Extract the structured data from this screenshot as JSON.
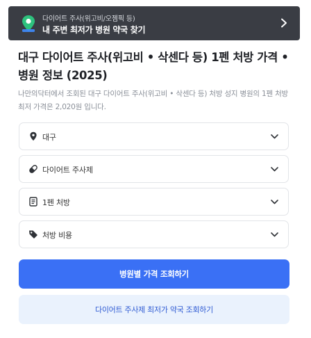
{
  "banner": {
    "subtitle": "다이어트 주사(위고비/오젬픽 등)",
    "title": "내 주변 최저가 병원 약국 찾기",
    "icon": "map-pin-icon",
    "chevron": "chevron-right-icon"
  },
  "page": {
    "title": "대구 다이어트 주사(위고비 • 삭센다 등) 1펜 처방 가격 • 병원 정보 (2025)",
    "description": "나만의닥터에서 조회된 대구 다이어트 주사(위고비 • 삭센다 등) 처방 성지 병원의 1펜 처방 최저 가격은 2,020원 입니다."
  },
  "filters": [
    {
      "label": "대구",
      "icon": "location-pin-icon"
    },
    {
      "label": "다이어트 주사제",
      "icon": "pill-icon"
    },
    {
      "label": "1펜 처방",
      "icon": "document-icon"
    },
    {
      "label": "처방 비용",
      "icon": "price-tag-icon"
    }
  ],
  "buttons": {
    "primary": "병원별 가격 조회하기",
    "secondary": "다이어트 주사제 최저가 약국 조회하기"
  },
  "colors": {
    "banner_bg": "#3a3d44",
    "primary": "#3a70f5",
    "secondary_bg": "#eaf2fd",
    "secondary_text": "#2f5bd3"
  }
}
